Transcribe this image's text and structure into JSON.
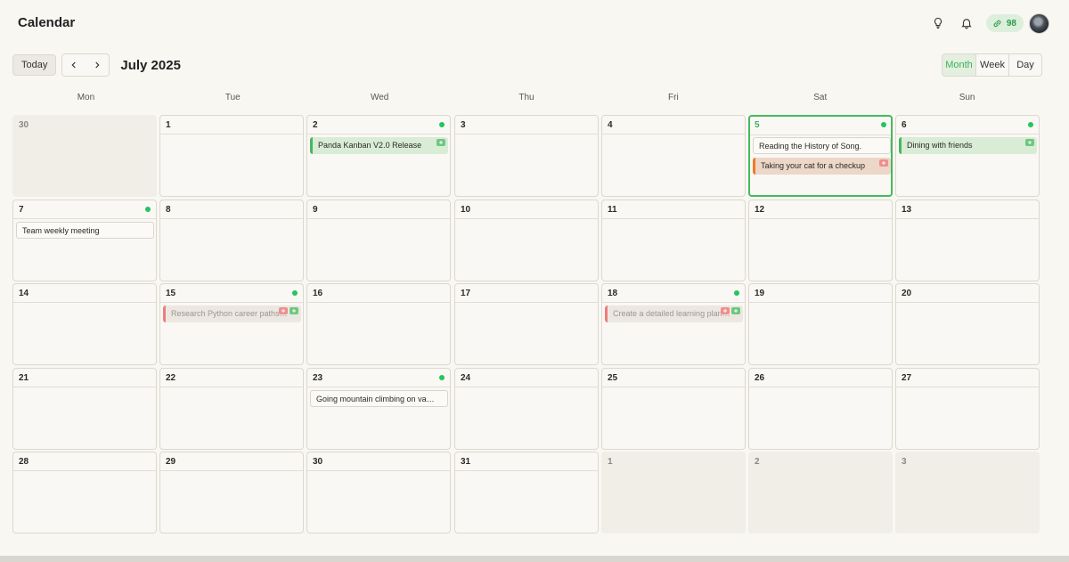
{
  "app": {
    "title": "Calendar"
  },
  "header": {
    "credits": "98",
    "icons": [
      "lightbulb-icon",
      "bell-icon",
      "link-icon"
    ]
  },
  "toolbar": {
    "today_label": "Today",
    "prev_icon": "chevron-left-icon",
    "next_icon": "chevron-right-icon",
    "month_label": "July 2025"
  },
  "views": [
    {
      "label": "Month",
      "active": true
    },
    {
      "label": "Week",
      "active": false
    },
    {
      "label": "Day",
      "active": false
    }
  ],
  "weekdays": [
    "Mon",
    "Tue",
    "Wed",
    "Thu",
    "Fri",
    "Sat",
    "Sun"
  ],
  "weeks": [
    [
      {
        "day": "30",
        "outside": true
      },
      {
        "day": "1"
      },
      {
        "day": "2",
        "dot": true,
        "events": [
          {
            "title": "Panda Kanban V2.0 Release",
            "style": "green",
            "tags": [
              "g"
            ]
          }
        ]
      },
      {
        "day": "3"
      },
      {
        "day": "4"
      },
      {
        "day": "5",
        "dot": true,
        "today": true,
        "events": [
          {
            "title": "Reading the History of Song.",
            "style": "plain",
            "tags": []
          },
          {
            "title": "Taking your cat for a checkup",
            "style": "orange",
            "tags": [
              "r"
            ]
          }
        ]
      },
      {
        "day": "6",
        "dot": true,
        "events": [
          {
            "title": "Dining with friends",
            "style": "green",
            "tags": [
              "g"
            ]
          }
        ]
      }
    ],
    [
      {
        "day": "7",
        "dot": true,
        "events": [
          {
            "title": "Team weekly meeting",
            "style": "plain",
            "tags": []
          }
        ]
      },
      {
        "day": "8"
      },
      {
        "day": "9"
      },
      {
        "day": "10"
      },
      {
        "day": "11"
      },
      {
        "day": "12"
      },
      {
        "day": "13"
      }
    ],
    [
      {
        "day": "14"
      },
      {
        "day": "15",
        "dot": true,
        "events": [
          {
            "title": "Research Python career paths and opportunities",
            "style": "faded",
            "tags": [
              "r",
              "g"
            ]
          }
        ]
      },
      {
        "day": "16"
      },
      {
        "day": "17"
      },
      {
        "day": "18",
        "dot": true,
        "events": [
          {
            "title": "Create a detailed learning plan and schedule",
            "style": "faded",
            "tags": [
              "r",
              "g"
            ]
          }
        ]
      },
      {
        "day": "19"
      },
      {
        "day": "20"
      }
    ],
    [
      {
        "day": "21"
      },
      {
        "day": "22"
      },
      {
        "day": "23",
        "dot": true,
        "events": [
          {
            "title": "Going mountain climbing on vacation",
            "style": "plain",
            "tags": []
          }
        ]
      },
      {
        "day": "24"
      },
      {
        "day": "25"
      },
      {
        "day": "26"
      },
      {
        "day": "27"
      }
    ],
    [
      {
        "day": "28"
      },
      {
        "day": "29"
      },
      {
        "day": "30"
      },
      {
        "day": "31"
      },
      {
        "day": "1",
        "outside": true
      },
      {
        "day": "2",
        "outside": true
      },
      {
        "day": "3",
        "outside": true
      }
    ]
  ],
  "colors": {
    "accent": "#46b85f",
    "dot": "#22c55e",
    "orange": "#f07a2b",
    "red": "#ef7c7c"
  }
}
